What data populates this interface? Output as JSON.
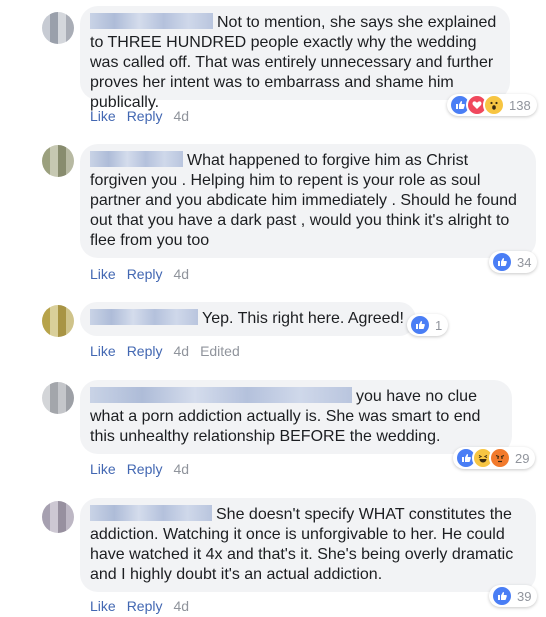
{
  "actions": {
    "like": "Like",
    "reply": "Reply",
    "edited": "Edited"
  },
  "comments": [
    {
      "text": "Not to mention, she says she explained to THREE HUNDRED people exactly why the wedding was called off. That was entirely unnecessary and further proves her intent was to embarrass and shame him publically.",
      "time": "4d",
      "reaction_count": "138",
      "reactions": [
        "like-icon",
        "love-icon",
        "wow-icon"
      ]
    },
    {
      "text": "What happened to forgive him as Christ forgiven you . Helping him to repent is your role as soul partner and you abdicate him immediately . Should he found out that you have a dark past , would you think it's alright to flee from you too",
      "time": "4d",
      "reaction_count": "34",
      "reactions": [
        "like-icon"
      ]
    },
    {
      "text": "Yep. This right here. Agreed!",
      "time": "4d",
      "reaction_count": "1",
      "reactions": [
        "like-icon"
      ]
    },
    {
      "text": "you have no clue what a porn addiction actually is. She was smart to end this unhealthy relationship BEFORE the wedding.",
      "time": "4d",
      "reaction_count": "29",
      "reactions": [
        "like-icon",
        "haha-icon",
        "angry-icon"
      ]
    },
    {
      "text": "She doesn't specify WHAT constitutes the addiction. Watching it once is unforgivable to her. He could have watched it 4x and that's it. She's being overly dramatic and I highly doubt it's an actual addiction.",
      "time": "4d",
      "reaction_count": "39",
      "reactions": [
        "like-icon"
      ]
    }
  ],
  "colors": {
    "link": "#4267b2",
    "bubble": "#f2f3f5",
    "like": "#4a7ef5",
    "love": "#f0485d",
    "wow": "#f7c542",
    "angry": "#f27a2c"
  }
}
